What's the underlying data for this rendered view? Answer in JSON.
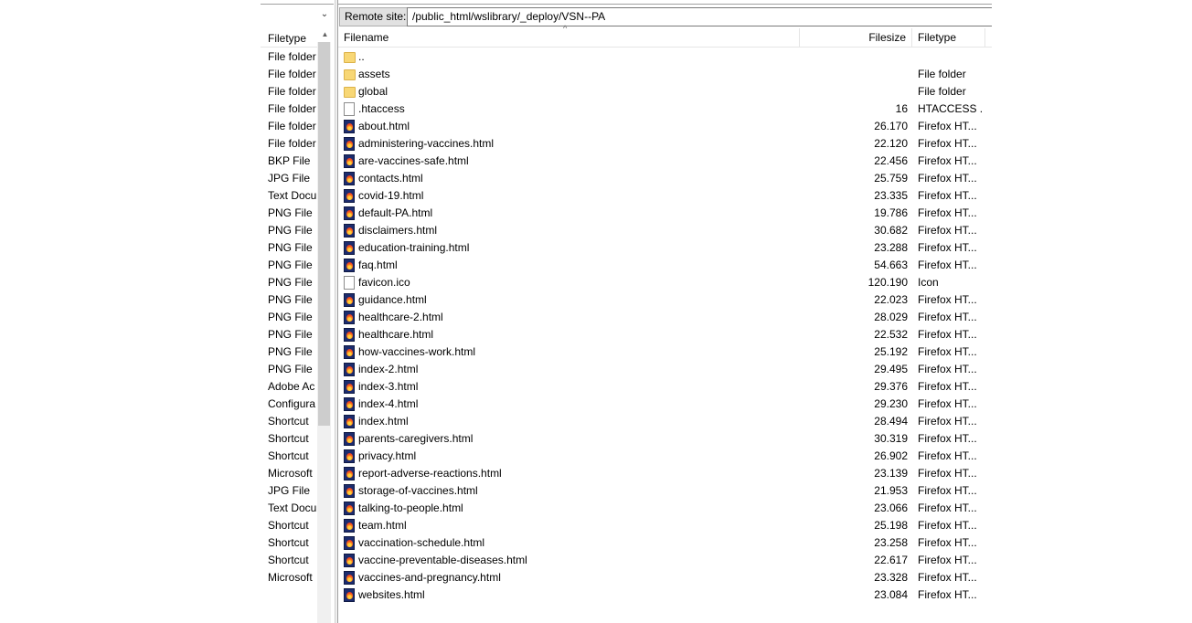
{
  "left_pane": {
    "chevron_icon": "chevron-down-icon",
    "header": {
      "filetype": "Filetype"
    },
    "sort_icon": "sort-up-icon",
    "rows": [
      "File folder",
      "File folder",
      "File folder",
      "File folder",
      "File folder",
      "File folder",
      "BKP File",
      "JPG File",
      "Text Docu",
      "PNG File",
      "PNG File",
      "PNG File",
      "PNG File",
      "PNG File",
      "PNG File",
      "PNG File",
      "PNG File",
      "PNG File",
      "PNG File",
      "Adobe Ac",
      "Configura",
      "Shortcut",
      "Shortcut",
      "Shortcut",
      "Microsoft",
      "JPG File",
      "Text Docu",
      "Shortcut",
      "Shortcut",
      "Shortcut",
      "Microsoft"
    ]
  },
  "remote": {
    "label": "Remote site:",
    "path": "/public_html/wslibrary/_deploy/VSN--PA"
  },
  "columns": {
    "filename": "Filename",
    "filesize": "Filesize",
    "filetype": "Filetype",
    "sort_caret": "^"
  },
  "files": [
    {
      "name": "..",
      "size": "",
      "type": "",
      "icon": "folder-icon"
    },
    {
      "name": "assets",
      "size": "",
      "type": "File folder",
      "icon": "folder-icon"
    },
    {
      "name": "global",
      "size": "",
      "type": "File folder",
      "icon": "folder-icon"
    },
    {
      "name": ".htaccess",
      "size": "16",
      "type": "HTACCESS ...",
      "icon": "file-icon"
    },
    {
      "name": "about.html",
      "size": "26.170",
      "type": "Firefox HT...",
      "icon": "firefox-html-icon"
    },
    {
      "name": "administering-vaccines.html",
      "size": "22.120",
      "type": "Firefox HT...",
      "icon": "firefox-html-icon"
    },
    {
      "name": "are-vaccines-safe.html",
      "size": "22.456",
      "type": "Firefox HT...",
      "icon": "firefox-html-icon"
    },
    {
      "name": "contacts.html",
      "size": "25.759",
      "type": "Firefox HT...",
      "icon": "firefox-html-icon"
    },
    {
      "name": "covid-19.html",
      "size": "23.335",
      "type": "Firefox HT...",
      "icon": "firefox-html-icon"
    },
    {
      "name": "default-PA.html",
      "size": "19.786",
      "type": "Firefox HT...",
      "icon": "firefox-html-icon"
    },
    {
      "name": "disclaimers.html",
      "size": "30.682",
      "type": "Firefox HT...",
      "icon": "firefox-html-icon"
    },
    {
      "name": "education-training.html",
      "size": "23.288",
      "type": "Firefox HT...",
      "icon": "firefox-html-icon"
    },
    {
      "name": "faq.html",
      "size": "54.663",
      "type": "Firefox HT...",
      "icon": "firefox-html-icon"
    },
    {
      "name": "favicon.ico",
      "size": "120.190",
      "type": "Icon",
      "icon": "file-icon"
    },
    {
      "name": "guidance.html",
      "size": "22.023",
      "type": "Firefox HT...",
      "icon": "firefox-html-icon"
    },
    {
      "name": "healthcare-2.html",
      "size": "28.029",
      "type": "Firefox HT...",
      "icon": "firefox-html-icon"
    },
    {
      "name": "healthcare.html",
      "size": "22.532",
      "type": "Firefox HT...",
      "icon": "firefox-html-icon"
    },
    {
      "name": "how-vaccines-work.html",
      "size": "25.192",
      "type": "Firefox HT...",
      "icon": "firefox-html-icon"
    },
    {
      "name": "index-2.html",
      "size": "29.495",
      "type": "Firefox HT...",
      "icon": "firefox-html-icon"
    },
    {
      "name": "index-3.html",
      "size": "29.376",
      "type": "Firefox HT...",
      "icon": "firefox-html-icon"
    },
    {
      "name": "index-4.html",
      "size": "29.230",
      "type": "Firefox HT...",
      "icon": "firefox-html-icon"
    },
    {
      "name": "index.html",
      "size": "28.494",
      "type": "Firefox HT...",
      "icon": "firefox-html-icon"
    },
    {
      "name": "parents-caregivers.html",
      "size": "30.319",
      "type": "Firefox HT...",
      "icon": "firefox-html-icon"
    },
    {
      "name": "privacy.html",
      "size": "26.902",
      "type": "Firefox HT...",
      "icon": "firefox-html-icon"
    },
    {
      "name": "report-adverse-reactions.html",
      "size": "23.139",
      "type": "Firefox HT...",
      "icon": "firefox-html-icon"
    },
    {
      "name": "storage-of-vaccines.html",
      "size": "21.953",
      "type": "Firefox HT...",
      "icon": "firefox-html-icon"
    },
    {
      "name": "talking-to-people.html",
      "size": "23.066",
      "type": "Firefox HT...",
      "icon": "firefox-html-icon"
    },
    {
      "name": "team.html",
      "size": "25.198",
      "type": "Firefox HT...",
      "icon": "firefox-html-icon"
    },
    {
      "name": "vaccination-schedule.html",
      "size": "23.258",
      "type": "Firefox HT...",
      "icon": "firefox-html-icon"
    },
    {
      "name": "vaccine-preventable-diseases.html",
      "size": "22.617",
      "type": "Firefox HT...",
      "icon": "firefox-html-icon"
    },
    {
      "name": "vaccines-and-pregnancy.html",
      "size": "23.328",
      "type": "Firefox HT...",
      "icon": "firefox-html-icon"
    },
    {
      "name": "websites.html",
      "size": "23.084",
      "type": "Firefox HT...",
      "icon": "firefox-html-icon"
    }
  ]
}
